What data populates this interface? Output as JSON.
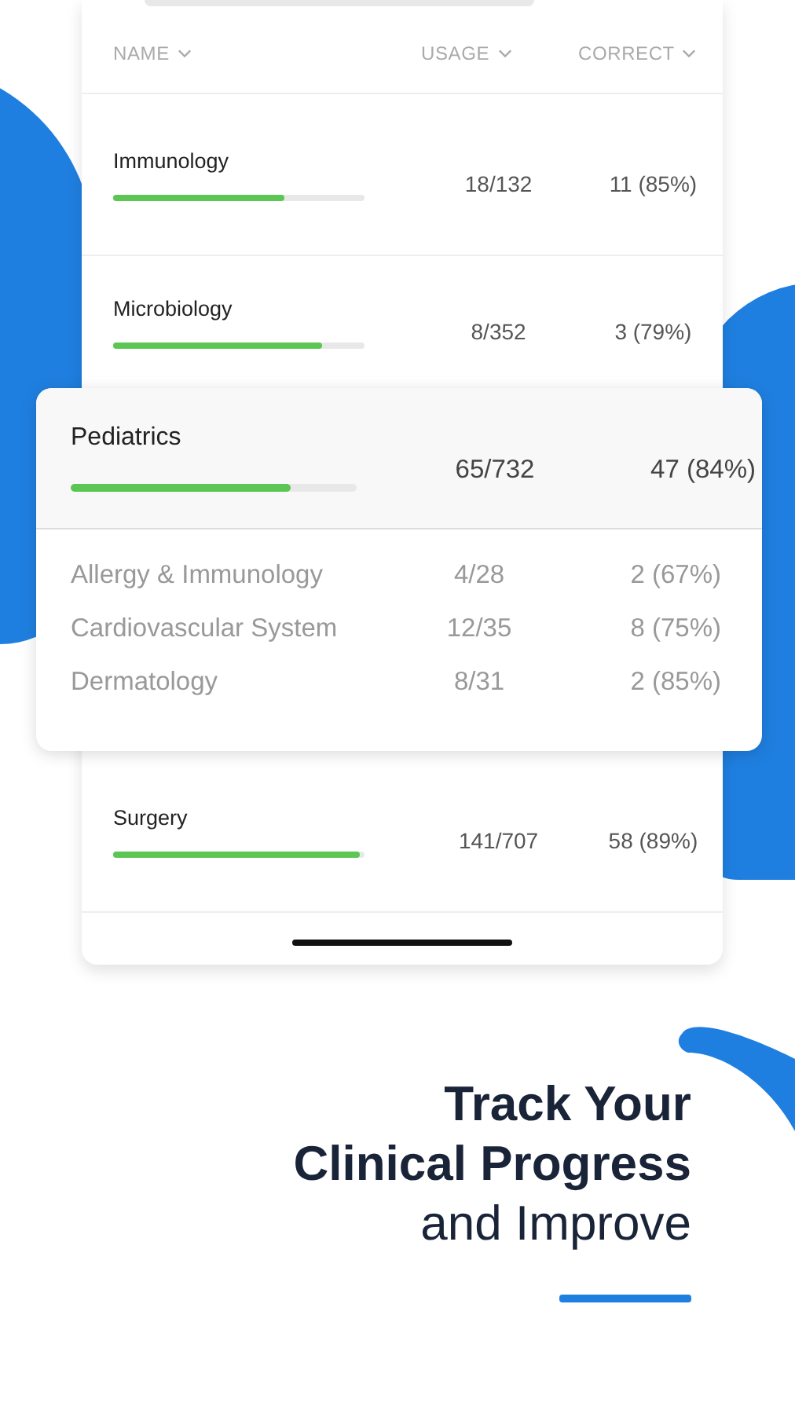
{
  "table": {
    "columns": [
      {
        "label": "NAME"
      },
      {
        "label": "USAGE"
      },
      {
        "label": "CORRECT"
      }
    ],
    "rows": [
      {
        "name": "Immunology",
        "usage": "18/132",
        "correct": "11 (85%)",
        "level": 0.68,
        "expanded": false,
        "children": []
      },
      {
        "name": "Microbiology",
        "usage": "8/352",
        "correct": "3 (79%)",
        "level": 0.83,
        "expanded": false,
        "children": []
      },
      {
        "name": "Pediatrics",
        "usage": "65/732",
        "correct": "47 (84%)",
        "level": 0.77,
        "expanded": true,
        "children": [
          {
            "name": "Allergy & Immunology",
            "usage": "4/28",
            "correct": "2 (67%)"
          },
          {
            "name": "Cardiovascular System",
            "usage": "12/35",
            "correct": "8 (75%)"
          },
          {
            "name": "Dermatology",
            "usage": "8/31",
            "correct": "2 (85%)"
          }
        ]
      },
      {
        "name": "Surgery",
        "usage": "141/707",
        "correct": "58 (89%)",
        "level": 0.98,
        "expanded": false,
        "children": []
      }
    ]
  },
  "headline": "**Track Your**\n**Clinical Progress**\nand Improve"
}
